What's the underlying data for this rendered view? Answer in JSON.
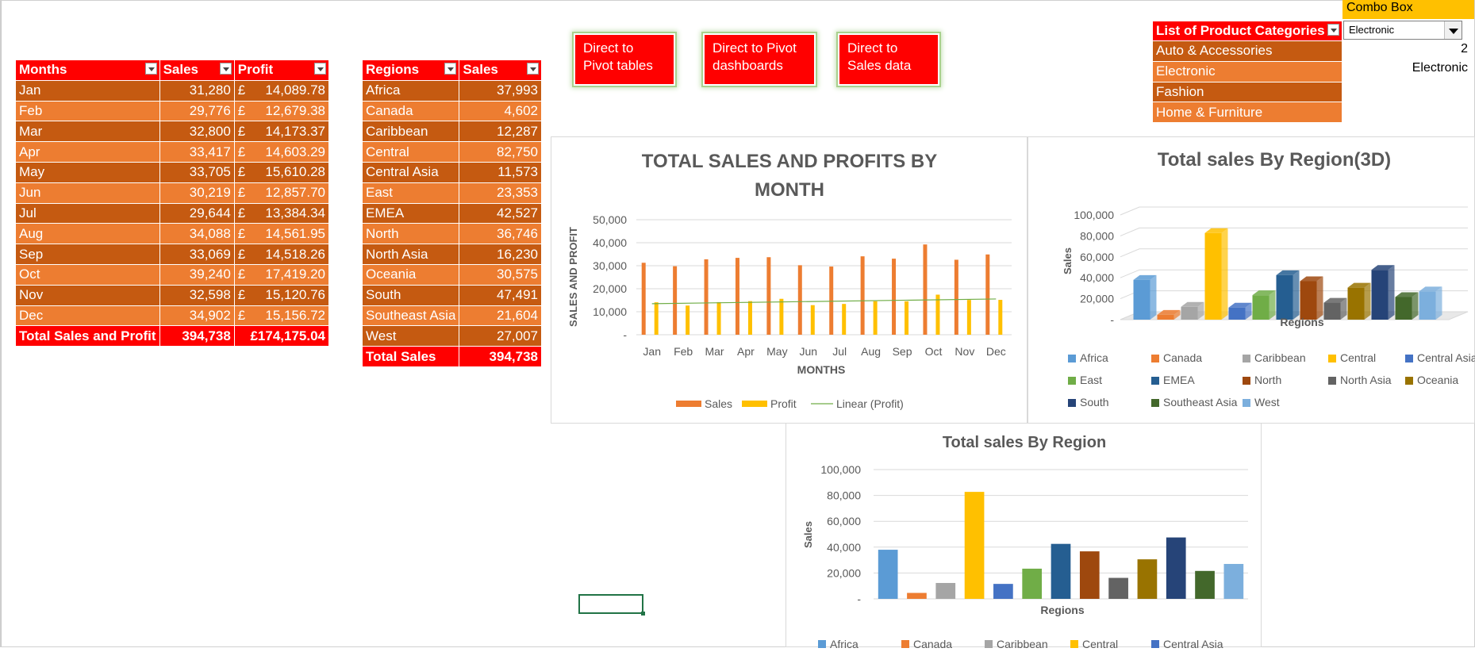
{
  "months_table": {
    "headers": [
      "Months",
      "Sales",
      "Profit"
    ],
    "rows": [
      [
        "Jan",
        "31,280",
        "£",
        "14,089.78"
      ],
      [
        "Feb",
        "29,776",
        "£",
        "12,679.38"
      ],
      [
        "Mar",
        "32,800",
        "£",
        "14,173.37"
      ],
      [
        "Apr",
        "33,417",
        "£",
        "14,603.29"
      ],
      [
        "May",
        "33,705",
        "£",
        "15,610.28"
      ],
      [
        "Jun",
        "30,219",
        "£",
        "12,857.70"
      ],
      [
        "Jul",
        "29,644",
        "£",
        "13,384.34"
      ],
      [
        "Aug",
        "34,088",
        "£",
        "14,561.95"
      ],
      [
        "Sep",
        "33,069",
        "£",
        "14,518.26"
      ],
      [
        "Oct",
        "39,240",
        "£",
        "17,419.20"
      ],
      [
        "Nov",
        "32,598",
        "£",
        "15,120.76"
      ],
      [
        "Dec",
        "34,902",
        "£",
        "15,156.72"
      ]
    ],
    "total": [
      "Total Sales and Profit",
      "394,738",
      "£174,175.04"
    ]
  },
  "regions_table": {
    "headers": [
      "Regions",
      "Sales"
    ],
    "rows": [
      [
        "Africa",
        "37,993"
      ],
      [
        "Canada",
        "4,602"
      ],
      [
        "Caribbean",
        "12,287"
      ],
      [
        "Central",
        "82,750"
      ],
      [
        "Central Asia",
        "11,573"
      ],
      [
        "East",
        "23,353"
      ],
      [
        "EMEA",
        "42,527"
      ],
      [
        "North",
        "36,746"
      ],
      [
        "North Asia",
        "16,230"
      ],
      [
        "Oceania",
        "30,575"
      ],
      [
        "South",
        "47,491"
      ],
      [
        "Southeast Asia",
        "21,604"
      ],
      [
        "West",
        "27,007"
      ]
    ],
    "total": [
      "Total Sales",
      "394,738"
    ]
  },
  "buttons": {
    "pivot_tables": "Direct to\nPivot tables",
    "pivot_dashboards": "Direct to Pivot\ndashboards",
    "sales_data": "Direct to\nSales data"
  },
  "category_list": {
    "header": "List of Product Categories",
    "items": [
      "Auto & Accessories",
      "Electronic",
      "Fashion",
      "Home & Furniture"
    ]
  },
  "combo": {
    "label": "Combo Box",
    "value": "Electronic",
    "index_cell": "2",
    "result_cell": "Electronic"
  },
  "colors": {
    "header_red": "#ff0000",
    "row_dark": "#c55a11",
    "row_light": "#ed7d31",
    "sales_bar": "#ed7d31",
    "profit_bar": "#ffc000",
    "trend": "#70ad47"
  },
  "region_colors": [
    "#5b9bd5",
    "#ed7d31",
    "#a5a5a5",
    "#ffc000",
    "#4472c4",
    "#70ad47",
    "#255e91",
    "#9e480e",
    "#636363",
    "#997300",
    "#264478",
    "#43682b",
    "#7cafdd"
  ],
  "chart_data": [
    {
      "type": "bar",
      "title": "TOTAL SALES AND PROFITS BY MONTH",
      "xlabel": "MONTHS",
      "ylabel": "SALES AND PROFIT",
      "categories": [
        "Jan",
        "Feb",
        "Mar",
        "Apr",
        "May",
        "Jun",
        "Jul",
        "Aug",
        "Sep",
        "Oct",
        "Nov",
        "Dec"
      ],
      "series": [
        {
          "name": "Sales",
          "values": [
            31280,
            29776,
            32800,
            33417,
            33705,
            30219,
            29644,
            34088,
            33069,
            39240,
            32598,
            34902
          ]
        },
        {
          "name": "Profit",
          "values": [
            14089.78,
            12679.38,
            14173.37,
            14603.29,
            15610.28,
            12857.7,
            13384.34,
            14561.95,
            14518.26,
            17419.2,
            15120.76,
            15156.72
          ]
        }
      ],
      "trendline": {
        "name": "Linear (Profit)"
      },
      "ylim": [
        0,
        50000
      ],
      "yticks": [
        "-",
        "10,000",
        "20,000",
        "30,000",
        "40,000",
        "50,000"
      ],
      "legend": "bottom"
    },
    {
      "type": "bar",
      "title": "Total sales By Region(3D)",
      "xlabel": "Regions",
      "ylabel": "Sales",
      "categories": [
        "Africa",
        "Canada",
        "Caribbean",
        "Central",
        "Central Asia",
        "East",
        "EMEA",
        "North",
        "North Asia",
        "Oceania",
        "South",
        "Southeast Asia",
        "West"
      ],
      "values": [
        37993,
        4602,
        12287,
        82750,
        11573,
        23353,
        42527,
        36746,
        16230,
        30575,
        47491,
        21604,
        27007
      ],
      "ylim": [
        0,
        100000
      ],
      "yticks": [
        "-",
        "20,000",
        "40,000",
        "60,000",
        "80,000",
        "100,000"
      ],
      "legend": "bottom"
    },
    {
      "type": "bar",
      "title": "Total sales By Region",
      "xlabel": "Regions",
      "ylabel": "Sales",
      "categories": [
        "Africa",
        "Canada",
        "Caribbean",
        "Central",
        "Central Asia",
        "East",
        "EMEA",
        "North",
        "North Asia",
        "Oceania",
        "South",
        "Southeast Asia",
        "West"
      ],
      "values": [
        37993,
        4602,
        12287,
        82750,
        11573,
        23353,
        42527,
        36746,
        16230,
        30575,
        47491,
        21604,
        27007
      ],
      "ylim": [
        0,
        100000
      ],
      "yticks": [
        "-",
        "20,000",
        "40,000",
        "60,000",
        "80,000",
        "100,000"
      ],
      "legend": "bottom"
    }
  ]
}
